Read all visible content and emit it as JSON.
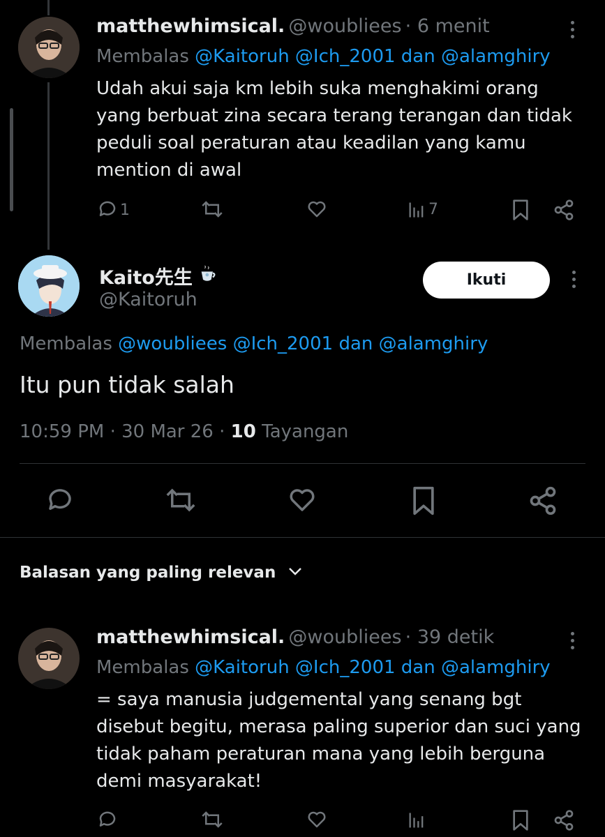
{
  "tweet1": {
    "name": "matthewhimsical.",
    "handle": "@woubliees",
    "time": "· 6 menit",
    "reply_prefix": "Membalas",
    "reply_mentions": "@Kaitoruh @Ich_2001 dan @alamghiry",
    "text": "Udah akui saja km lebih suka menghakimi orang yang berbuat zina secara terang terangan dan tidak peduli soal peraturan atau keadilan yang kamu mention di awal",
    "reply_count": "1",
    "views_count": "7"
  },
  "main": {
    "name": "Kaito先生",
    "handle": "@Kaitoruh",
    "follow_label": "Ikuti",
    "reply_prefix": "Membalas",
    "reply_mentions": "@woubliees @Ich_2001 dan @alamghiry",
    "text": "Itu pun tidak salah",
    "meta_time": "10:59 PM · 30 Mar 26 ·",
    "meta_views": "10",
    "meta_views_label": "Tayangan"
  },
  "replies_header": {
    "label": "Balasan yang paling relevan"
  },
  "tweet2": {
    "name": "matthewhimsical.",
    "handle": "@woubliees",
    "time": "· 39 detik",
    "reply_prefix": "Membalas",
    "reply_mentions": "@Kaitoruh @Ich_2001 dan @alamghiry",
    "text": "= saya manusia judgemental yang senang bgt disebut begitu, merasa paling superior dan suci yang tidak paham peraturan mana yang lebih berguna demi masyarakat!"
  },
  "colors": {
    "background": "#000000",
    "text": "#e7e9ea",
    "muted": "#71767b",
    "link": "#1d9bf0",
    "divider": "#2f3336"
  }
}
